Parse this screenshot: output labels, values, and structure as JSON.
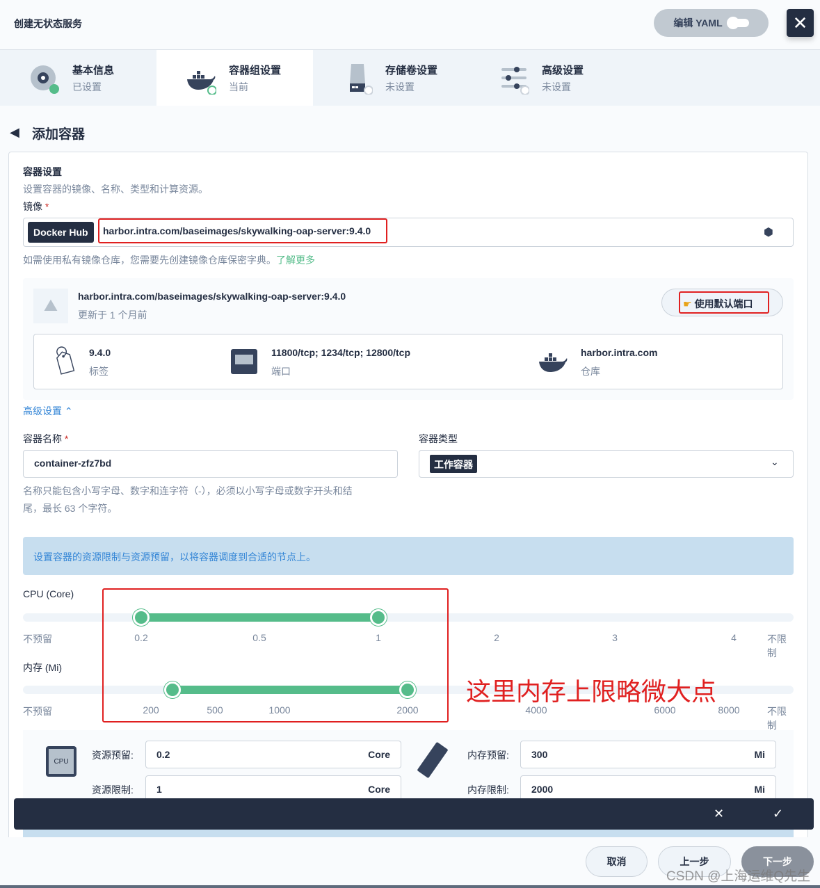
{
  "header": {
    "title": "创建无状态服务",
    "edit_yaml": "编辑 YAML",
    "close_icon": "close-icon"
  },
  "steps": [
    {
      "name": "基本信息",
      "status": "已设置"
    },
    {
      "name": "容器组设置",
      "status": "当前"
    },
    {
      "name": "存储卷设置",
      "status": "未设置"
    },
    {
      "name": "高级设置",
      "status": "未设置"
    }
  ],
  "page": {
    "back_title": "添加容器"
  },
  "container": {
    "section_title": "容器设置",
    "section_desc": "设置容器的镜像、名称、类型和计算资源。",
    "image_label": "镜像",
    "required": "*",
    "registry": "Docker Hub",
    "image_value": "harbor.intra.com/baseimages/skywalking-oap-server:9.4.0",
    "hint": "如需使用私有镜像仓库，您需要先创建镜像仓库保密字典。",
    "learn_more": "了解更多"
  },
  "image_info": {
    "name": "harbor.intra.com/baseimages/skywalking-oap-server:9.4.0",
    "updated": "更新于 1 个月前",
    "use_default_ports": "使用默认端口",
    "tag": "9.4.0",
    "tag_label": "标签",
    "ports": "11800/tcp; 1234/tcp; 12800/tcp",
    "ports_label": "端口",
    "registry": "harbor.intra.com",
    "registry_label": "仓库"
  },
  "advanced": {
    "label": "高级设置"
  },
  "name_field": {
    "label": "容器名称",
    "required": "*",
    "value": "container-zfz7bd",
    "hint1": "名称只能包含小写字母、数字和连字符（-），必须以小写字母或数字开头和结",
    "hint2": "尾，最长 63 个字符。"
  },
  "type_field": {
    "label": "容器类型",
    "value": "工作容器"
  },
  "resource_tip": "设置容器的资源限制与资源预留，以将容器调度到合适的节点上。",
  "cpu": {
    "label": "CPU (Core)",
    "ticks": [
      "不预留",
      "0.2",
      "0.5",
      "1",
      "2",
      "3",
      "4",
      "不限制"
    ],
    "reserve": 0.2,
    "limit": 1
  },
  "memory": {
    "label": "内存 (Mi)",
    "ticks": [
      "不预留",
      "200",
      "500",
      "1000",
      "2000",
      "4000",
      "6000",
      "8000",
      "不限制"
    ],
    "reserve": 300,
    "limit": 2000
  },
  "annotation": "这里内存上限略微大点",
  "resources": {
    "cpu_reserve_label": "资源预留:",
    "cpu_reserve": "0.2",
    "cpu_limit_label": "资源限制:",
    "cpu_limit": "1",
    "cpu_unit": "Core",
    "cpu_chip": "CPU",
    "mem_reserve_label": "内存预留:",
    "mem_reserve": "300",
    "mem_limit_label": "内存限制:",
    "mem_limit": "2000",
    "mem_unit": "Mi"
  },
  "footer": {
    "cancel": "取消",
    "prev": "上一步",
    "next": "下一步",
    "watermark": "CSDN @上海运维Q先生"
  },
  "colors": {
    "accent": "#55bc8a",
    "dark": "#242e42",
    "annotation": "#e02020"
  }
}
